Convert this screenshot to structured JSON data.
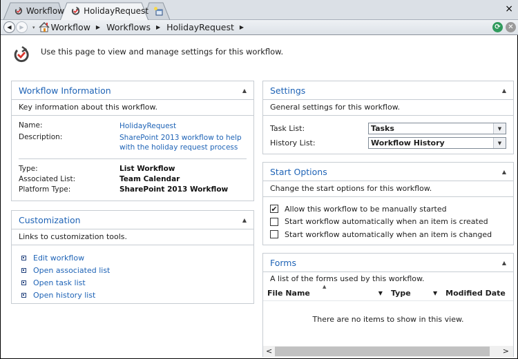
{
  "window": {
    "tabs": [
      {
        "label": "Workflow",
        "icon": "workflow-icon",
        "active": false
      },
      {
        "label": "HolidayRequest",
        "icon": "workflow-icon",
        "active": true
      },
      {
        "label": "",
        "icon": "new-tab-icon",
        "active": false
      }
    ],
    "close_label": "×"
  },
  "nav": {
    "back_glyph": "◀",
    "forward_glyph": "▶",
    "history_glyph": "▾",
    "crumb_arrow": "▶",
    "breadcrumbs": [
      "Workflow",
      "Workflows",
      "HolidayRequest"
    ],
    "refresh_glyph": "⟳",
    "stop_glyph": "✕"
  },
  "intro": {
    "text": "Use this page to view and manage settings for this workflow."
  },
  "workflow_info": {
    "title": "Workflow Information",
    "collapse_glyph": "▲",
    "description": "Key information about this workflow.",
    "fields_top": [
      {
        "label": "Name:",
        "value": "HolidayRequest"
      },
      {
        "label": "Description:",
        "value": "SharePoint 2013 workflow to help with the holiday request process"
      }
    ],
    "fields_bottom": [
      {
        "label": "Type:",
        "value": "List Workflow"
      },
      {
        "label": "Associated List:",
        "value": "Team Calendar"
      },
      {
        "label": "Platform Type:",
        "value": "SharePoint 2013 Workflow"
      }
    ]
  },
  "customization": {
    "title": "Customization",
    "collapse_glyph": "▲",
    "description": "Links to customization tools.",
    "links": [
      "Edit workflow",
      "Open associated list",
      "Open task list",
      "Open history list"
    ]
  },
  "settings": {
    "title": "Settings",
    "collapse_glyph": "▲",
    "description": "General settings for this workflow.",
    "task_list_label": "Task List:",
    "task_list_value": "Tasks",
    "history_list_label": "History List:",
    "history_list_value": "Workflow History",
    "dropdown_glyph": "▼"
  },
  "start_options": {
    "title": "Start Options",
    "collapse_glyph": "▲",
    "description": "Change the start options for this workflow.",
    "options": [
      {
        "label": "Allow this workflow to be manually started",
        "checked": true,
        "mark": "✔"
      },
      {
        "label": "Start workflow automatically when an item is created",
        "checked": false,
        "mark": ""
      },
      {
        "label": "Start workflow automatically when an item is changed",
        "checked": false,
        "mark": ""
      }
    ]
  },
  "forms": {
    "title": "Forms",
    "collapse_glyph": "▲",
    "description": "A list of the forms used by this workflow.",
    "columns": [
      "File Name",
      "Type",
      "Modified Date"
    ],
    "column_dropdown_glyph": "▼",
    "sort_glyph": "▲",
    "empty_text": "There are no items to show in this view.",
    "scroll_left": "<",
    "scroll_right": ">"
  }
}
